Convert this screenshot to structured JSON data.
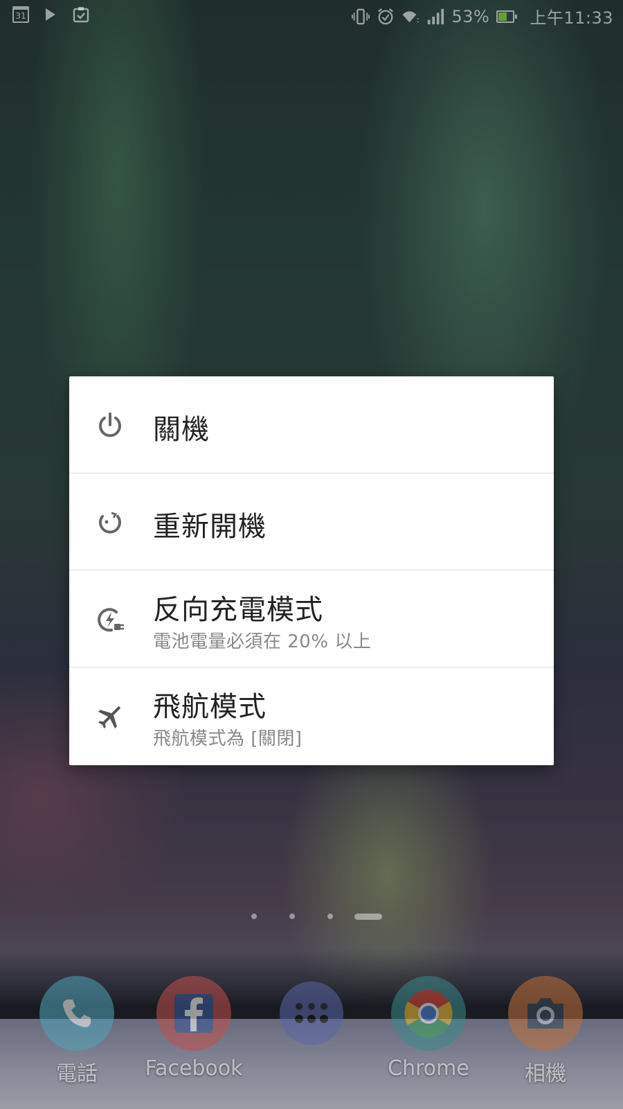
{
  "status_bar": {
    "calendar_day": "31",
    "icons_left": [
      "calendar-icon",
      "play-store-icon",
      "clipboard-icon"
    ],
    "icons_right": [
      "vibrate-icon",
      "alarm-icon",
      "wifi-icon",
      "signal-icon",
      "battery-charging-icon"
    ],
    "battery_percent": "53%",
    "time": "上午11:33"
  },
  "power_menu": {
    "items": [
      {
        "title": "關機",
        "subtitle": "",
        "icon": "power-icon"
      },
      {
        "title": "重新開機",
        "subtitle": "",
        "icon": "restart-icon"
      },
      {
        "title": "反向充電模式",
        "subtitle": "電池電量必須在 20% 以上",
        "icon": "reverse-charge-icon"
      },
      {
        "title": "飛航模式",
        "subtitle": "飛航模式為 [關閉]",
        "icon": "airplane-icon"
      }
    ]
  },
  "pager": {
    "pages": 4,
    "current": 4
  },
  "dock": {
    "apps": [
      {
        "label": "電話",
        "icon": "phone-icon",
        "color": "#4fa3b8"
      },
      {
        "label": "Facebook",
        "icon": "facebook-icon",
        "color": "#c0504d"
      },
      {
        "label": "",
        "icon": "app-drawer-icon",
        "color": "#5a66a8"
      },
      {
        "label": "Chrome",
        "icon": "chrome-icon",
        "color": "#3a8a8a"
      },
      {
        "label": "相機",
        "icon": "camera-icon",
        "color": "#c0703a"
      }
    ]
  }
}
